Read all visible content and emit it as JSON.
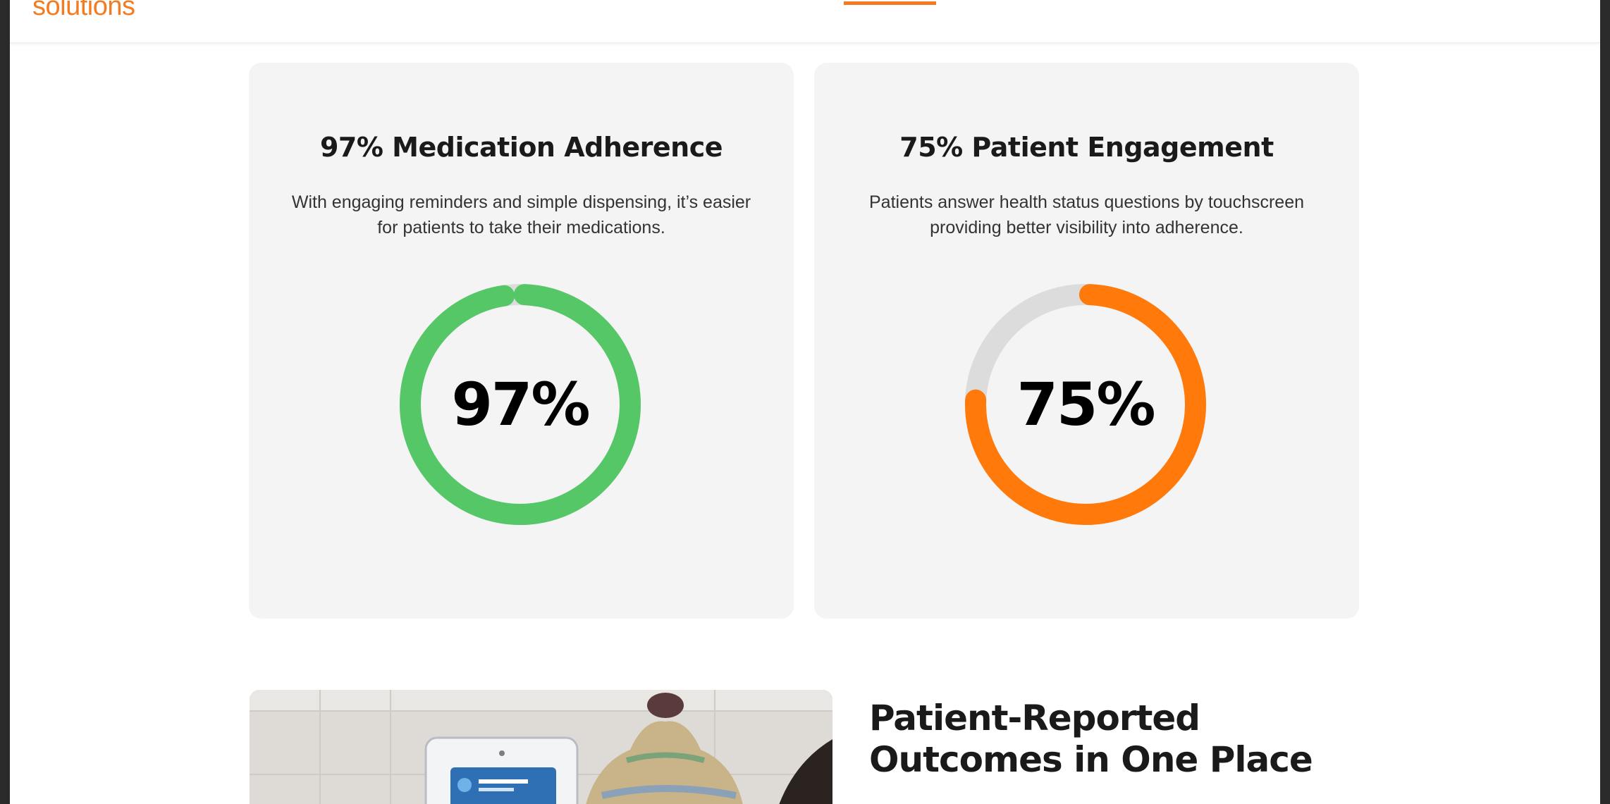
{
  "header": {
    "logo_text": "solutions"
  },
  "cards": [
    {
      "title": "97% Medication Adherence",
      "description": "With engaging reminders and simple dispensing, it’s easier for patients to take their medications.",
      "gauge_value": 97,
      "gauge_label": "97%",
      "gauge_color": "#56c767"
    },
    {
      "title": "75% Patient Engagement",
      "description": "Patients answer health status questions by touchscreen providing better visibility into adherence.",
      "gauge_value": 75,
      "gauge_label": "75%",
      "gauge_color": "#ff7a0a"
    }
  ],
  "colors": {
    "brand_orange": "#f47b20",
    "gauge_track": "#dcdcdc",
    "card_background": "#f4f4f4"
  },
  "section": {
    "title": "Patient-Reported Outcomes in One Place"
  },
  "scrollbar": {
    "visible": true
  }
}
